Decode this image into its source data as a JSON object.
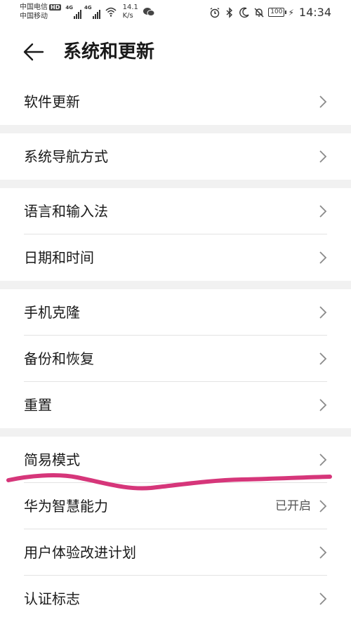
{
  "status_bar": {
    "carrier_1": "中国电信",
    "carrier_1_badge": "HD",
    "carrier_2": "中国移动",
    "network_type_1": "4G",
    "network_type_2": "4G",
    "net_speed_value": "14.1",
    "net_speed_unit": "K/s",
    "battery": "100",
    "time": "14:34",
    "icons": [
      "alarm-icon",
      "bluetooth-icon",
      "moon-icon",
      "mute-icon",
      "battery-icon",
      "charging-icon",
      "wifi-icon",
      "wechat-icon"
    ]
  },
  "header": {
    "title": "系统和更新"
  },
  "groups": [
    {
      "items": [
        {
          "label": "软件更新"
        }
      ]
    },
    {
      "items": [
        {
          "label": "系统导航方式"
        }
      ]
    },
    {
      "items": [
        {
          "label": "语言和输入法"
        },
        {
          "label": "日期和时间"
        }
      ]
    },
    {
      "items": [
        {
          "label": "手机克隆"
        },
        {
          "label": "备份和恢复"
        },
        {
          "label": "重置"
        }
      ]
    },
    {
      "items": [
        {
          "label": "简易模式"
        },
        {
          "label": "华为智慧能力",
          "value": "已开启"
        },
        {
          "label": "用户体验改进计划"
        },
        {
          "label": "认证标志"
        }
      ]
    }
  ],
  "colors": {
    "annotation": "#d6367a",
    "group_gap": "#f1f1f1",
    "divider": "#e3e3e3"
  }
}
